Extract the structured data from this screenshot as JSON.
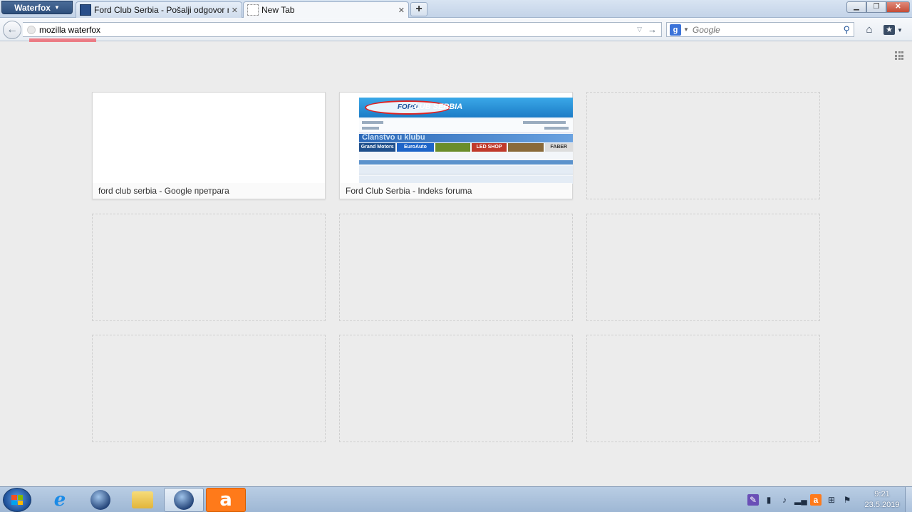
{
  "browser": {
    "app_button": "Waterfox",
    "tabs": [
      {
        "title": "Ford Club Serbia - Pošalji odgovor na..."
      },
      {
        "title": "New Tab"
      }
    ],
    "new_tab_label": "+",
    "url": "mozilla waterfox",
    "search": {
      "placeholder": "Google",
      "engine": "Google"
    }
  },
  "newtab_page": {
    "tiles": [
      {
        "title": "ford club serbia - Google претрага",
        "state": "blank-thumbnail"
      },
      {
        "title": "Ford Club Serbia - Indeks foruma",
        "state": "thumbnail"
      },
      {
        "title": "",
        "state": "empty"
      },
      {
        "title": "",
        "state": "empty"
      },
      {
        "title": "",
        "state": "empty"
      },
      {
        "title": "",
        "state": "empty"
      },
      {
        "title": "",
        "state": "empty"
      },
      {
        "title": "",
        "state": "empty"
      },
      {
        "title": "",
        "state": "empty"
      }
    ],
    "ford_thumbnail": {
      "logo": "FORD",
      "logo_tail": "CLUB SERBIA",
      "banner": "Članstvo u klubu",
      "ads": [
        "Grand Motors",
        "EuroAuto",
        "LED SHOP",
        "FABER"
      ]
    }
  },
  "taskbar": {
    "apps": [
      "start",
      "internet-explorer",
      "waterfox",
      "file-explorer",
      "waterfox-active",
      "avast"
    ],
    "clock_time": "9:21",
    "clock_date": "23.5.2019"
  }
}
